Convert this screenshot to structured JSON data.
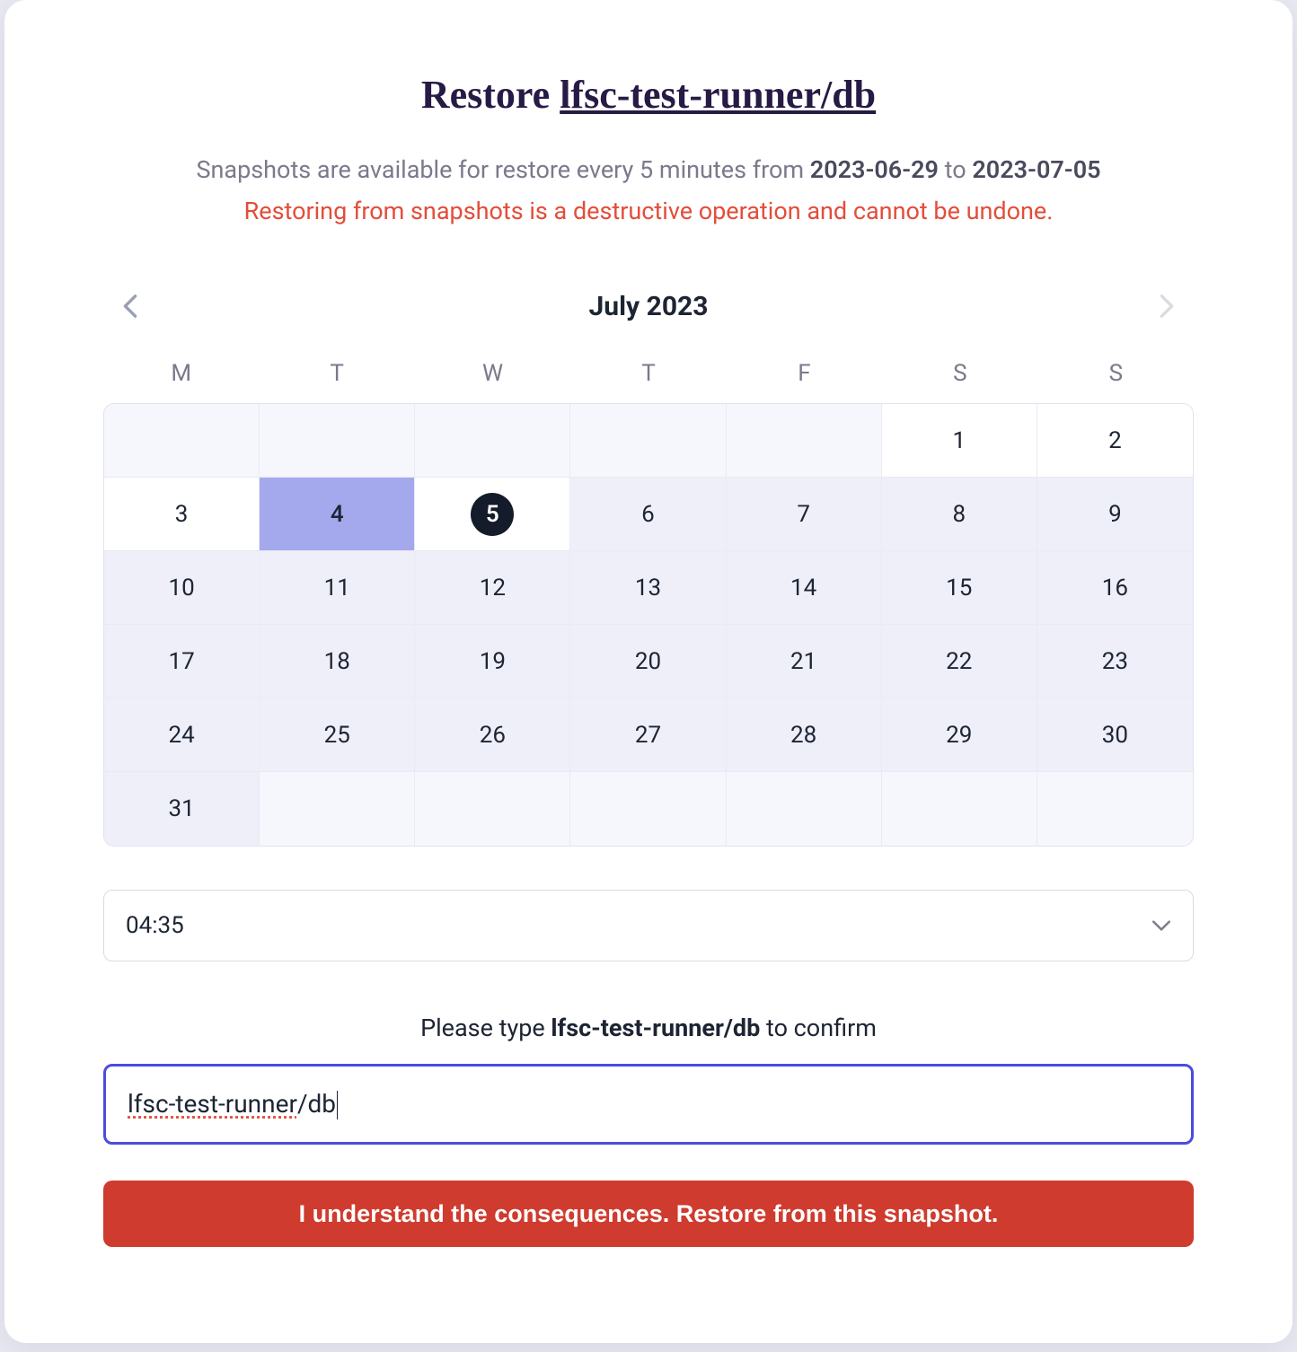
{
  "title": {
    "prefix": "Restore ",
    "target": "lfsc-test-runner/db"
  },
  "subtitle": {
    "pre": "Snapshots are available for restore every 5 minutes from ",
    "date_from": "2023-06-29",
    "mid": " to ",
    "date_to": "2023-07-05"
  },
  "warning": "Restoring from snapshots is a destructive operation and cannot be undone.",
  "calendar": {
    "month_label": "July 2023",
    "dow": [
      "M",
      "T",
      "W",
      "T",
      "F",
      "S",
      "S"
    ],
    "leading_blanks": 5,
    "days": [
      {
        "n": "1",
        "state": "avail"
      },
      {
        "n": "2",
        "state": "avail"
      },
      {
        "n": "3",
        "state": "avail"
      },
      {
        "n": "4",
        "state": "selected"
      },
      {
        "n": "5",
        "state": "today"
      },
      {
        "n": "6",
        "state": "dis"
      },
      {
        "n": "7",
        "state": "dis"
      },
      {
        "n": "8",
        "state": "dis"
      },
      {
        "n": "9",
        "state": "dis"
      },
      {
        "n": "10",
        "state": "dis"
      },
      {
        "n": "11",
        "state": "dis"
      },
      {
        "n": "12",
        "state": "dis"
      },
      {
        "n": "13",
        "state": "dis"
      },
      {
        "n": "14",
        "state": "dis"
      },
      {
        "n": "15",
        "state": "dis"
      },
      {
        "n": "16",
        "state": "dis"
      },
      {
        "n": "17",
        "state": "dis"
      },
      {
        "n": "18",
        "state": "dis"
      },
      {
        "n": "19",
        "state": "dis"
      },
      {
        "n": "20",
        "state": "dis"
      },
      {
        "n": "21",
        "state": "dis"
      },
      {
        "n": "22",
        "state": "dis"
      },
      {
        "n": "23",
        "state": "dis"
      },
      {
        "n": "24",
        "state": "dis"
      },
      {
        "n": "25",
        "state": "dis"
      },
      {
        "n": "26",
        "state": "dis"
      },
      {
        "n": "27",
        "state": "dis"
      },
      {
        "n": "28",
        "state": "dis"
      },
      {
        "n": "29",
        "state": "dis"
      },
      {
        "n": "30",
        "state": "dis"
      },
      {
        "n": "31",
        "state": "dis"
      }
    ]
  },
  "time": {
    "value": "04:35"
  },
  "confirm": {
    "pre": "Please type ",
    "target": "lfsc-test-runner/db",
    "post": " to confirm",
    "typed_underlined": "lfsc-test-runner",
    "typed_rest": "/db"
  },
  "button": "I understand the consequences. Restore from this snapshot."
}
